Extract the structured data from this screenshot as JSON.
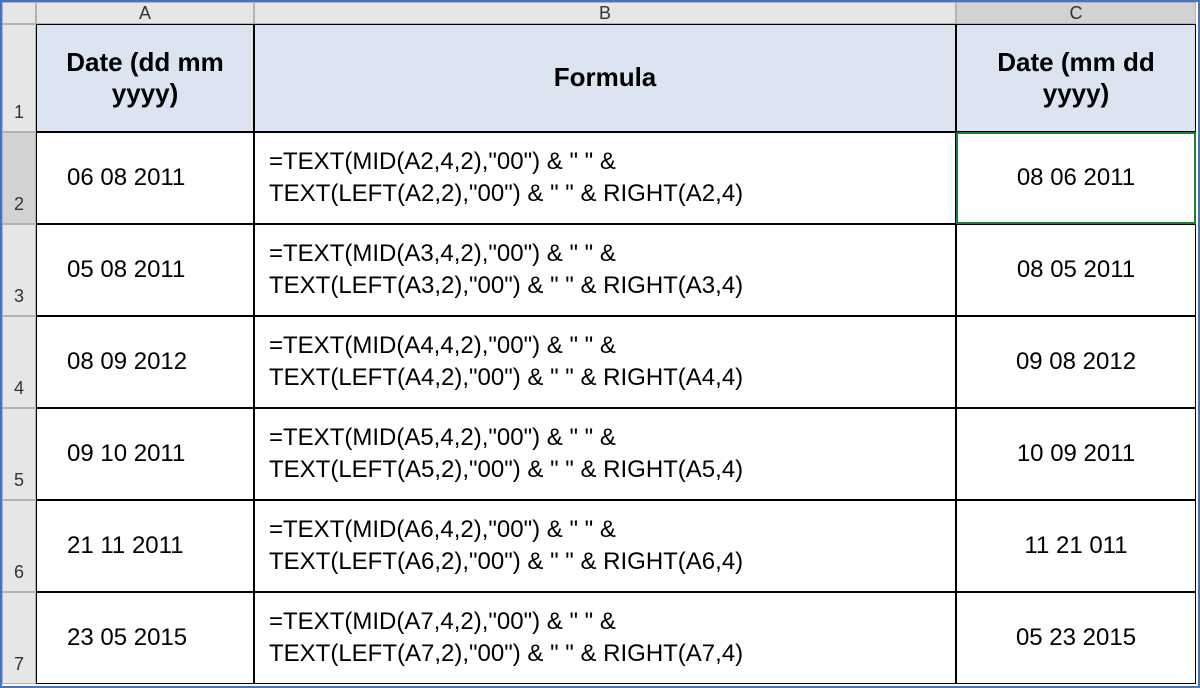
{
  "columns": {
    "A": "A",
    "B": "B",
    "C": "C"
  },
  "rowNumbers": [
    "1",
    "2",
    "3",
    "4",
    "5",
    "6",
    "7"
  ],
  "headers": {
    "A": "Date (dd mm yyyy)",
    "B": "Formula",
    "C": "Date (mm dd yyyy)"
  },
  "rows": [
    {
      "A": "06 08 2011",
      "B1": "=TEXT(MID(A2,4,2),\"00\") & \" \" &",
      "B2": "TEXT(LEFT(A2,2),\"00\") & \" \" & RIGHT(A2,4)",
      "C": "08 06 2011"
    },
    {
      "A": "05 08 2011",
      "B1": "=TEXT(MID(A3,4,2),\"00\") & \" \" &",
      "B2": "TEXT(LEFT(A3,2),\"00\") & \" \" & RIGHT(A3,4)",
      "C": "08 05 2011"
    },
    {
      "A": "08 09 2012",
      "B1": "=TEXT(MID(A4,4,2),\"00\") & \" \" &",
      "B2": "TEXT(LEFT(A4,2),\"00\") & \" \" & RIGHT(A4,4)",
      "C": "09 08 2012"
    },
    {
      "A": "09 10 2011",
      "B1": "=TEXT(MID(A5,4,2),\"00\") & \" \" &",
      "B2": "TEXT(LEFT(A5,2),\"00\") & \" \" & RIGHT(A5,4)",
      "C": "10 09 2011"
    },
    {
      "A": "21 11 2011",
      "B1": "=TEXT(MID(A6,4,2),\"00\") & \" \" &",
      "B2": "TEXT(LEFT(A6,2),\"00\") & \" \" & RIGHT(A6,4)",
      "C": "11 21 011"
    },
    {
      "A": "23 05 2015",
      "B1": "=TEXT(MID(A7,4,2),\"00\") & \" \" &",
      "B2": "TEXT(LEFT(A7,2),\"00\") & \" \" & RIGHT(A7,4)",
      "C": "05 23 2015"
    }
  ],
  "selected": {
    "cell": "C2"
  }
}
